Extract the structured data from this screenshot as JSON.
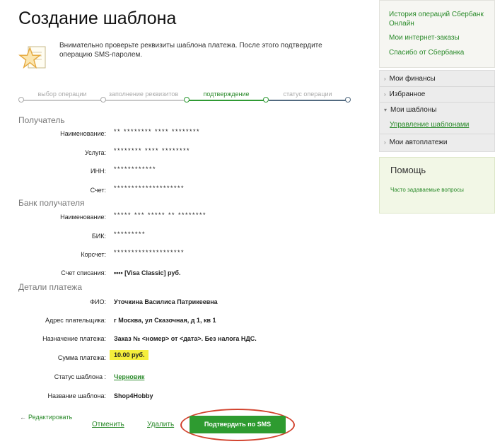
{
  "page_title": "Создание шаблона",
  "notice": {
    "text": "Внимательно проверьте реквизиты шаблона платежа. После этого подтвердите операцию SMS-паролем."
  },
  "progress": {
    "steps": [
      "выбор операции",
      "заполнение реквизитов",
      "подтверждение",
      "статус операции"
    ],
    "active_step": "подтверждение"
  },
  "recipient": {
    "section_title": "Получатель",
    "rows": [
      {
        "label": "Наименование:",
        "value": "** ******** **** ********"
      },
      {
        "label": "Услуга:",
        "value": "******** **** ********"
      },
      {
        "label": "ИНН:",
        "value": "************"
      },
      {
        "label": "Счет:",
        "value": "********************"
      }
    ]
  },
  "bank": {
    "section_title": "Банк получателя",
    "rows": [
      {
        "label": "Наименование:",
        "value": "***** *** ***** ** ********"
      },
      {
        "label": "БИК:",
        "value": "*********"
      },
      {
        "label": "Корсчет:",
        "value": "********************"
      }
    ],
    "account_label": "Счет списания:",
    "account_value": "••••     [Visa Classic]   руб."
  },
  "payment": {
    "section_title": "Детали платежа",
    "fio_label": "ФИО:",
    "fio_value": "Уточкина Василиса Патрикеевна",
    "address_label": "Адрес плательщика:",
    "address_value": "г Москва, ул Сказочная, д 1, кв 1",
    "purpose_label": "Назначение платежа:",
    "purpose_value": "Заказ № <номер> от <дата>. Без налога НДС.",
    "amount_label": "Сумма платежа:",
    "amount_value": "10.00 руб.",
    "status_label": "Статус шаблона :",
    "status_value": "Черновик",
    "name_label": "Название шаблона:",
    "name_value": "Shop4Hobby"
  },
  "actions": {
    "edit": "Редактировать",
    "cancel": "Отменить",
    "delete": "Удалить",
    "confirm": "Подтвердить по SMS"
  },
  "sidebar": {
    "top_links": [
      "История операций Сбербанк Онлайн",
      "Мои интернет-заказы",
      "Спасибо от Сбербанка"
    ],
    "menu": [
      "Мои финансы",
      "Избранное",
      "Мои шаблоны",
      "Мои автоплатежи"
    ],
    "submenu": "Управление шаблонами",
    "help_title": "Помощь",
    "help_link": "Часто задаваемые вопросы"
  },
  "colors": {
    "accent_green": "#2e9b30",
    "highlight": "#f5ee3c",
    "annotation_red": "#d2432e"
  }
}
